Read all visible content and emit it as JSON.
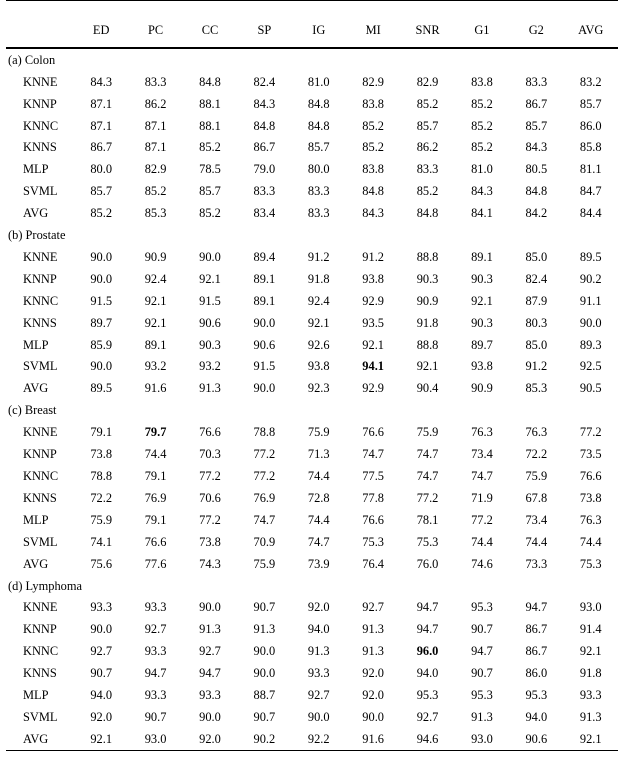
{
  "table": {
    "row_label_header": "",
    "columns": [
      "ED",
      "PC",
      "CC",
      "SP",
      "IG",
      "MI",
      "SNR",
      "G1",
      "G2",
      "AVG"
    ],
    "row_names": [
      "KNNE",
      "KNNP",
      "KNNC",
      "KNNS",
      "MLP",
      "SVML",
      "AVG"
    ],
    "sections": [
      {
        "label": "(a) Colon",
        "rows": [
          {
            "name": "KNNE",
            "values": [
              "84.3",
              "83.3",
              "84.8",
              "82.4",
              "81.0",
              "82.9",
              "82.9",
              "83.8",
              "83.3",
              "83.2"
            ],
            "bold": []
          },
          {
            "name": "KNNP",
            "values": [
              "87.1",
              "86.2",
              "88.1",
              "84.3",
              "84.8",
              "83.8",
              "85.2",
              "85.2",
              "86.7",
              "85.7"
            ],
            "bold": []
          },
          {
            "name": "KNNC",
            "values": [
              "87.1",
              "87.1",
              "88.1",
              "84.8",
              "84.8",
              "85.2",
              "85.7",
              "85.2",
              "85.7",
              "86.0"
            ],
            "bold": []
          },
          {
            "name": "KNNS",
            "values": [
              "86.7",
              "87.1",
              "85.2",
              "86.7",
              "85.7",
              "85.2",
              "86.2",
              "85.2",
              "84.3",
              "85.8"
            ],
            "bold": []
          },
          {
            "name": "MLP",
            "values": [
              "80.0",
              "82.9",
              "78.5",
              "79.0",
              "80.0",
              "83.8",
              "83.3",
              "81.0",
              "80.5",
              "81.1"
            ],
            "bold": []
          },
          {
            "name": "SVML",
            "values": [
              "85.7",
              "85.2",
              "85.7",
              "83.3",
              "83.3",
              "84.8",
              "85.2",
              "84.3",
              "84.8",
              "84.7"
            ],
            "bold": []
          },
          {
            "name": "AVG",
            "values": [
              "85.2",
              "85.3",
              "85.2",
              "83.4",
              "83.3",
              "84.3",
              "84.8",
              "84.1",
              "84.2",
              "84.4"
            ],
            "bold": []
          }
        ]
      },
      {
        "label": "(b) Prostate",
        "rows": [
          {
            "name": "KNNE",
            "values": [
              "90.0",
              "90.9",
              "90.0",
              "89.4",
              "91.2",
              "91.2",
              "88.8",
              "89.1",
              "85.0",
              "89.5"
            ],
            "bold": []
          },
          {
            "name": "KNNP",
            "values": [
              "90.0",
              "92.4",
              "92.1",
              "89.1",
              "91.8",
              "93.8",
              "90.3",
              "90.3",
              "82.4",
              "90.2"
            ],
            "bold": []
          },
          {
            "name": "KNNC",
            "values": [
              "91.5",
              "92.1",
              "91.5",
              "89.1",
              "92.4",
              "92.9",
              "90.9",
              "92.1",
              "87.9",
              "91.1"
            ],
            "bold": []
          },
          {
            "name": "KNNS",
            "values": [
              "89.7",
              "92.1",
              "90.6",
              "90.0",
              "92.1",
              "93.5",
              "91.8",
              "90.3",
              "80.3",
              "90.0"
            ],
            "bold": []
          },
          {
            "name": "MLP",
            "values": [
              "85.9",
              "89.1",
              "90.3",
              "90.6",
              "92.6",
              "92.1",
              "88.8",
              "89.7",
              "85.0",
              "89.3"
            ],
            "bold": []
          },
          {
            "name": "SVML",
            "values": [
              "90.0",
              "93.2",
              "93.2",
              "91.5",
              "93.8",
              "94.1",
              "92.1",
              "93.8",
              "91.2",
              "92.5"
            ],
            "bold": [
              5
            ]
          },
          {
            "name": "AVG",
            "values": [
              "89.5",
              "91.6",
              "91.3",
              "90.0",
              "92.3",
              "92.9",
              "90.4",
              "90.9",
              "85.3",
              "90.5"
            ],
            "bold": []
          }
        ]
      },
      {
        "label": "(c) Breast",
        "rows": [
          {
            "name": "KNNE",
            "values": [
              "79.1",
              "79.7",
              "76.6",
              "78.8",
              "75.9",
              "76.6",
              "75.9",
              "76.3",
              "76.3",
              "77.2"
            ],
            "bold": [
              1
            ]
          },
          {
            "name": "KNNP",
            "values": [
              "73.8",
              "74.4",
              "70.3",
              "77.2",
              "71.3",
              "74.7",
              "74.7",
              "73.4",
              "72.2",
              "73.5"
            ],
            "bold": []
          },
          {
            "name": "KNNC",
            "values": [
              "78.8",
              "79.1",
              "77.2",
              "77.2",
              "74.4",
              "77.5",
              "74.7",
              "74.7",
              "75.9",
              "76.6"
            ],
            "bold": []
          },
          {
            "name": "KNNS",
            "values": [
              "72.2",
              "76.9",
              "70.6",
              "76.9",
              "72.8",
              "77.8",
              "77.2",
              "71.9",
              "67.8",
              "73.8"
            ],
            "bold": []
          },
          {
            "name": "MLP",
            "values": [
              "75.9",
              "79.1",
              "77.2",
              "74.7",
              "74.4",
              "76.6",
              "78.1",
              "77.2",
              "73.4",
              "76.3"
            ],
            "bold": []
          },
          {
            "name": "SVML",
            "values": [
              "74.1",
              "76.6",
              "73.8",
              "70.9",
              "74.7",
              "75.3",
              "75.3",
              "74.4",
              "74.4",
              "74.4"
            ],
            "bold": []
          },
          {
            "name": "AVG",
            "values": [
              "75.6",
              "77.6",
              "74.3",
              "75.9",
              "73.9",
              "76.4",
              "76.0",
              "74.6",
              "73.3",
              "75.3"
            ],
            "bold": []
          }
        ]
      },
      {
        "label": "(d) Lymphoma",
        "rows": [
          {
            "name": "KNNE",
            "values": [
              "93.3",
              "93.3",
              "90.0",
              "90.7",
              "92.0",
              "92.7",
              "94.7",
              "95.3",
              "94.7",
              "93.0"
            ],
            "bold": []
          },
          {
            "name": "KNNP",
            "values": [
              "90.0",
              "92.7",
              "91.3",
              "91.3",
              "94.0",
              "91.3",
              "94.7",
              "90.7",
              "86.7",
              "91.4"
            ],
            "bold": []
          },
          {
            "name": "KNNC",
            "values": [
              "92.7",
              "93.3",
              "92.7",
              "90.0",
              "91.3",
              "91.3",
              "96.0",
              "94.7",
              "86.7",
              "92.1"
            ],
            "bold": [
              6
            ]
          },
          {
            "name": "KNNS",
            "values": [
              "90.7",
              "94.7",
              "94.7",
              "90.0",
              "93.3",
              "92.0",
              "94.0",
              "90.7",
              "86.0",
              "91.8"
            ],
            "bold": []
          },
          {
            "name": "MLP",
            "values": [
              "94.0",
              "93.3",
              "93.3",
              "88.7",
              "92.7",
              "92.0",
              "95.3",
              "95.3",
              "95.3",
              "93.3"
            ],
            "bold": []
          },
          {
            "name": "SVML",
            "values": [
              "92.0",
              "90.7",
              "90.0",
              "90.7",
              "90.0",
              "90.0",
              "92.7",
              "91.3",
              "94.0",
              "91.3"
            ],
            "bold": []
          },
          {
            "name": "AVG",
            "values": [
              "92.1",
              "93.0",
              "92.0",
              "90.2",
              "92.2",
              "91.6",
              "94.6",
              "93.0",
              "90.6",
              "92.1"
            ],
            "bold": []
          }
        ]
      }
    ]
  }
}
